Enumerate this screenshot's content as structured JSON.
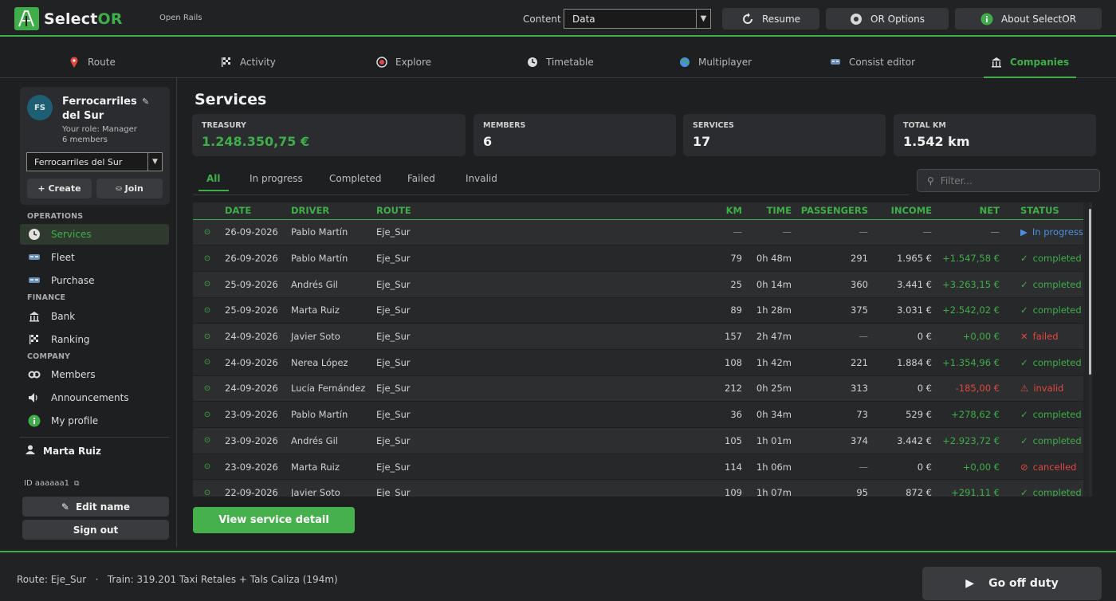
{
  "app": {
    "brand_prefix": "Select",
    "brand_suffix": "OR",
    "subtitle": "Open Rails"
  },
  "topbar": {
    "content_label": "Content",
    "content_value": "Data",
    "resume_label": "Resume",
    "options_label": "OR Options",
    "about_label": "About SelectOR"
  },
  "tabs": [
    {
      "label": "Route",
      "icon": "map-pin-icon"
    },
    {
      "label": "Activity",
      "icon": "checkered-flag-icon"
    },
    {
      "label": "Explore",
      "icon": "compass-icon"
    },
    {
      "label": "Timetable",
      "icon": "clock-icon"
    },
    {
      "label": "Multiplayer",
      "icon": "globe-icon"
    },
    {
      "label": "Consist editor",
      "icon": "train-icon"
    },
    {
      "label": "Companies",
      "icon": "building-icon",
      "active": true
    }
  ],
  "company": {
    "initials": "FS",
    "name": "Ferrocarriles del Sur",
    "role": "Your role: Manager",
    "members": "6 members",
    "selected": "Ferrocarriles del Sur",
    "create_label": "+ Create",
    "join_label": "Join"
  },
  "sidebar": {
    "operations_head": "OPERATIONS",
    "services": "Services",
    "fleet": "Fleet",
    "purchase": "Purchase",
    "finance_head": "FINANCE",
    "bank": "Bank",
    "ranking": "Ranking",
    "company_head": "COMPANY",
    "members": "Members",
    "announcements": "Announcements",
    "my_profile": "My profile",
    "user_name": "Marta Ruiz",
    "user_id": "ID aaaaaa1",
    "edit_name": "Edit name",
    "sign_out": "Sign out"
  },
  "main": {
    "title": "Services",
    "stats": {
      "treasury_label": "TREASURY",
      "treasury_value": "1.248.350,75 €",
      "members_label": "MEMBERS",
      "members_value": "6",
      "services_label": "SERVICES",
      "services_value": "17",
      "km_label": "TOTAL KM",
      "km_value": "1.542 km"
    },
    "filters": [
      "All",
      "In progress",
      "Completed",
      "Failed",
      "Invalid"
    ],
    "filter_placeholder": "Filter...",
    "columns": [
      "DATE",
      "DRIVER",
      "ROUTE",
      "KM",
      "TIME",
      "PASSENGERS",
      "INCOME",
      "NET",
      "STATUS"
    ],
    "rows": [
      {
        "date": "26-09-2026",
        "driver": "Pablo Martín",
        "route": "Eje_Sur",
        "km": "—",
        "time": "—",
        "passengers": "—",
        "income": "—",
        "net": "—",
        "status": "In progress",
        "status_icon": "▶",
        "kind": "progress"
      },
      {
        "date": "26-09-2026",
        "driver": "Pablo Martín",
        "route": "Eje_Sur",
        "km": "79",
        "time": "0h 48m",
        "passengers": "291",
        "income": "1.965 €",
        "net": "+1.547,58 €",
        "status": "completed",
        "status_icon": "✓",
        "kind": "completed"
      },
      {
        "date": "25-09-2026",
        "driver": "Andrés Gil",
        "route": "Eje_Sur",
        "km": "25",
        "time": "0h 14m",
        "passengers": "360",
        "income": "3.441 €",
        "net": "+3.263,15 €",
        "status": "completed",
        "status_icon": "✓",
        "kind": "completed"
      },
      {
        "date": "25-09-2026",
        "driver": "Marta Ruiz",
        "route": "Eje_Sur",
        "km": "89",
        "time": "1h 28m",
        "passengers": "375",
        "income": "3.031 €",
        "net": "+2.542,02 €",
        "status": "completed",
        "status_icon": "✓",
        "kind": "completed"
      },
      {
        "date": "24-09-2026",
        "driver": "Javier Soto",
        "route": "Eje_Sur",
        "km": "157",
        "time": "2h 47m",
        "passengers": "—",
        "income": "0 €",
        "net": "+0,00 €",
        "status": "failed",
        "status_icon": "✕",
        "kind": "failed"
      },
      {
        "date": "24-09-2026",
        "driver": "Nerea López",
        "route": "Eje_Sur",
        "km": "108",
        "time": "1h 42m",
        "passengers": "221",
        "income": "1.884 €",
        "net": "+1.354,96 €",
        "status": "completed",
        "status_icon": "✓",
        "kind": "completed"
      },
      {
        "date": "24-09-2026",
        "driver": "Lucía Fernández",
        "route": "Eje_Sur",
        "km": "212",
        "time": "0h 25m",
        "passengers": "313",
        "income": "0 €",
        "net": "-185,00 €",
        "status": "invalid",
        "status_icon": "⚠",
        "kind": "invalid"
      },
      {
        "date": "23-09-2026",
        "driver": "Pablo Martín",
        "route": "Eje_Sur",
        "km": "36",
        "time": "0h 34m",
        "passengers": "73",
        "income": "529 €",
        "net": "+278,62 €",
        "status": "completed",
        "status_icon": "✓",
        "kind": "completed"
      },
      {
        "date": "23-09-2026",
        "driver": "Andrés Gil",
        "route": "Eje_Sur",
        "km": "105",
        "time": "1h 01m",
        "passengers": "374",
        "income": "3.442 €",
        "net": "+2.923,72 €",
        "status": "completed",
        "status_icon": "✓",
        "kind": "completed"
      },
      {
        "date": "23-09-2026",
        "driver": "Marta Ruiz",
        "route": "Eje_Sur",
        "km": "114",
        "time": "1h 06m",
        "passengers": "—",
        "income": "0 €",
        "net": "+0,00 €",
        "status": "cancelled",
        "status_icon": "⊘",
        "kind": "cancelled"
      },
      {
        "date": "22-09-2026",
        "driver": "Javier Soto",
        "route": "Eje_Sur",
        "km": "109",
        "time": "1h 07m",
        "passengers": "95",
        "income": "872 €",
        "net": "+291,11 €",
        "status": "completed",
        "status_icon": "✓",
        "kind": "completed"
      }
    ],
    "view_detail": "View service detail"
  },
  "footer": {
    "status_text": "Route: Eje_Sur   ·   Train: 319.201 Taxi Retales + Tals Caliza (194m)",
    "duty_label": "Go off duty"
  },
  "colors": {
    "accent": "#3fae49",
    "error": "#e2483f",
    "info": "#4a8fe0"
  }
}
